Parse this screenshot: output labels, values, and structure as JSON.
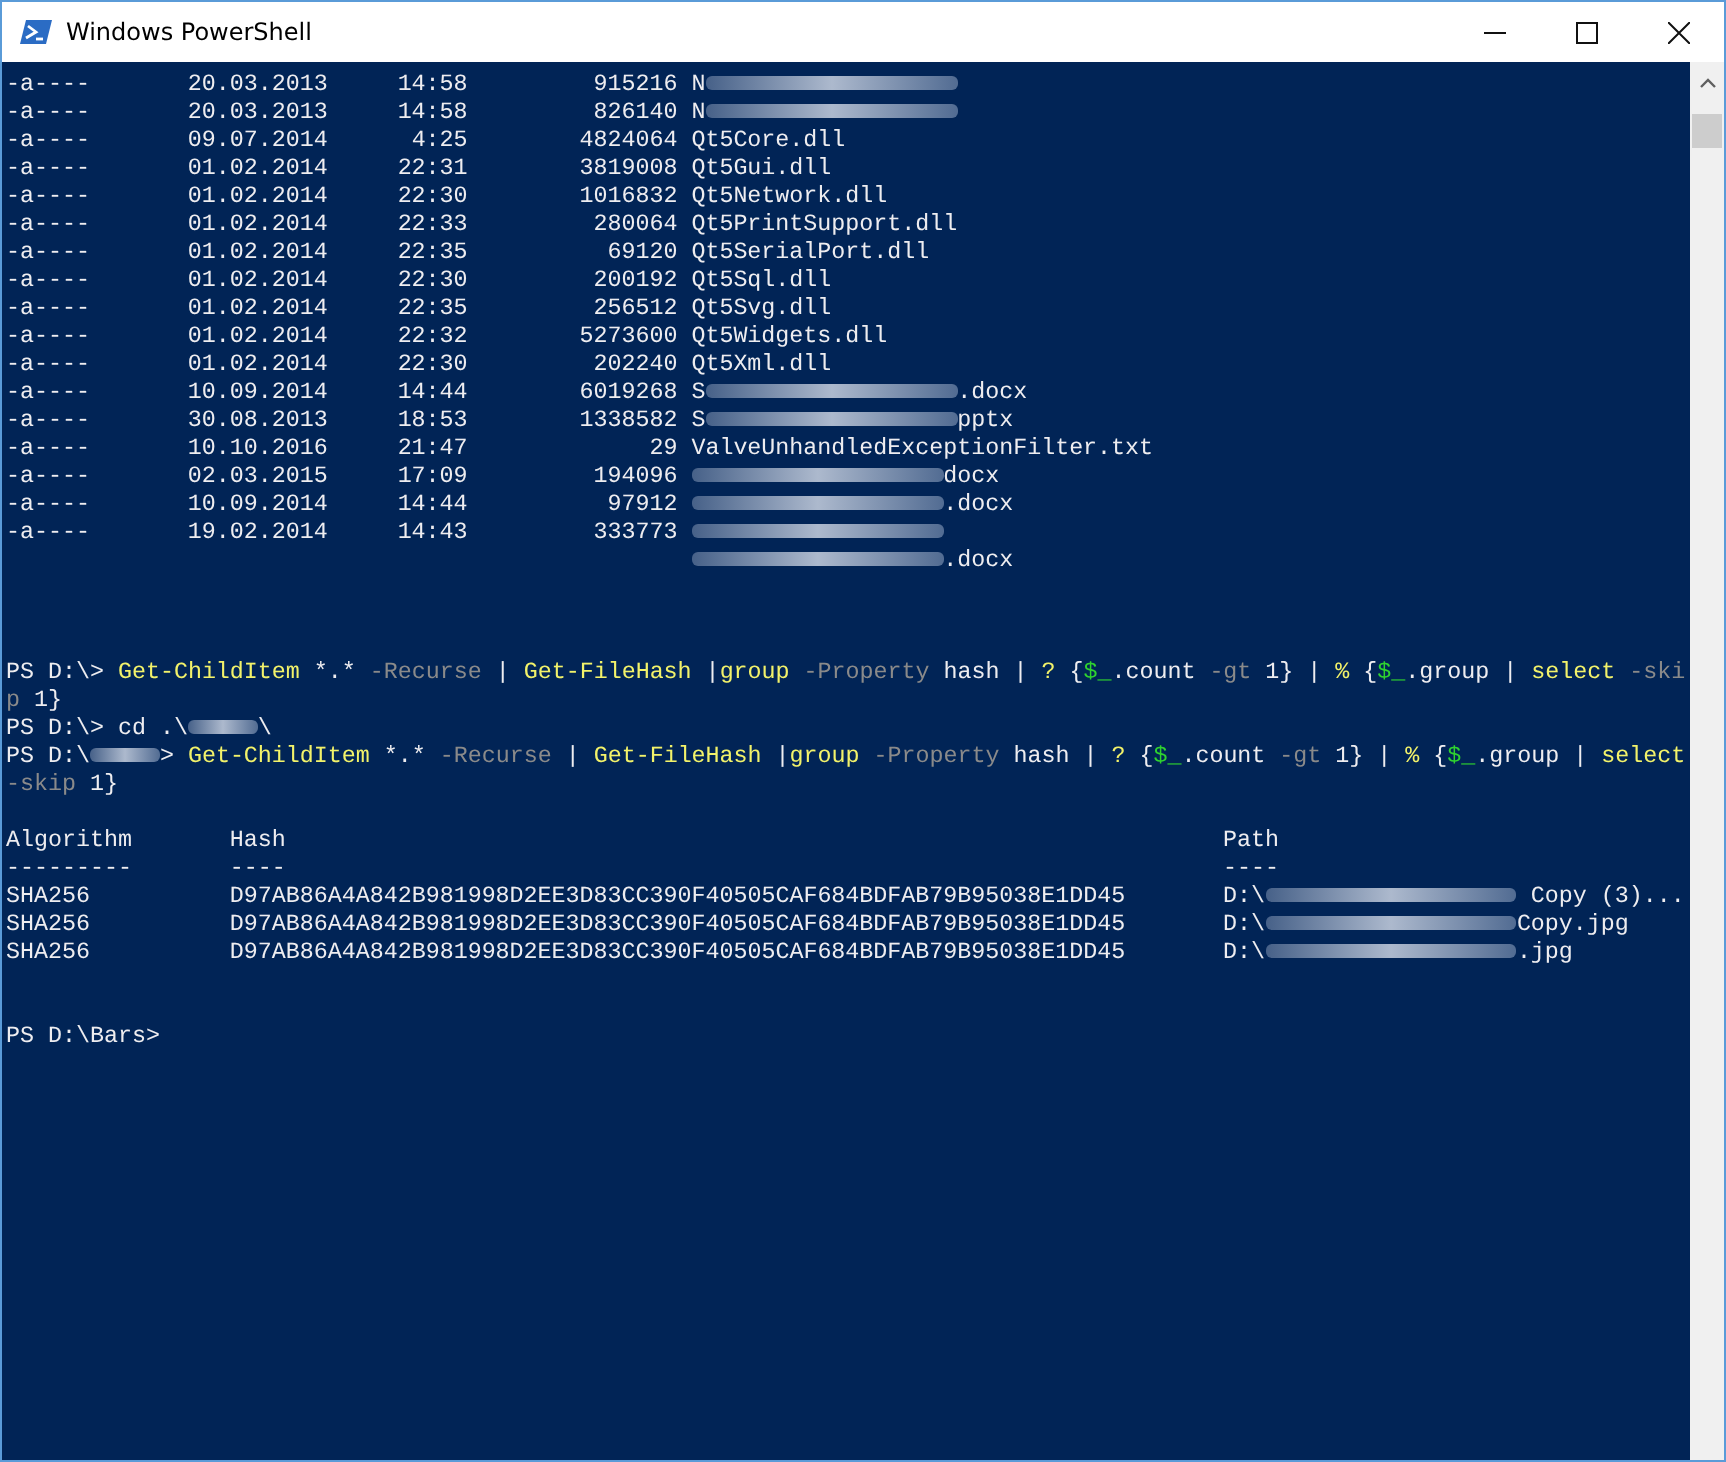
{
  "window": {
    "title": "Windows PowerShell"
  },
  "lines": [
    {
      "kind": "file",
      "mode": "-a----",
      "date": "20.03.2013",
      "time": "14:58",
      "length": "915216",
      "name": [
        {
          "kind": "text",
          "text": "N"
        },
        {
          "kind": "redacted"
        }
      ]
    },
    {
      "kind": "file",
      "mode": "-a----",
      "date": "20.03.2013",
      "time": "14:58",
      "length": "826140",
      "name": [
        {
          "kind": "text",
          "text": "N"
        },
        {
          "kind": "redacted"
        }
      ]
    },
    {
      "kind": "file",
      "mode": "-a----",
      "date": "09.07.2014",
      "time": "4:25",
      "length": "4824064",
      "name": [
        {
          "kind": "text",
          "text": "Qt5Core.dll"
        }
      ]
    },
    {
      "kind": "file",
      "mode": "-a----",
      "date": "01.02.2014",
      "time": "22:31",
      "length": "3819008",
      "name": [
        {
          "kind": "text",
          "text": "Qt5Gui.dll"
        }
      ]
    },
    {
      "kind": "file",
      "mode": "-a----",
      "date": "01.02.2014",
      "time": "22:30",
      "length": "1016832",
      "name": [
        {
          "kind": "text",
          "text": "Qt5Network.dll"
        }
      ]
    },
    {
      "kind": "file",
      "mode": "-a----",
      "date": "01.02.2014",
      "time": "22:33",
      "length": "280064",
      "name": [
        {
          "kind": "text",
          "text": "Qt5PrintSupport.dll"
        }
      ]
    },
    {
      "kind": "file",
      "mode": "-a----",
      "date": "01.02.2014",
      "time": "22:35",
      "length": "69120",
      "name": [
        {
          "kind": "text",
          "text": "Qt5SerialPort.dll"
        }
      ]
    },
    {
      "kind": "file",
      "mode": "-a----",
      "date": "01.02.2014",
      "time": "22:30",
      "length": "200192",
      "name": [
        {
          "kind": "text",
          "text": "Qt5Sql.dll"
        }
      ]
    },
    {
      "kind": "file",
      "mode": "-a----",
      "date": "01.02.2014",
      "time": "22:35",
      "length": "256512",
      "name": [
        {
          "kind": "text",
          "text": "Qt5Svg.dll"
        }
      ]
    },
    {
      "kind": "file",
      "mode": "-a----",
      "date": "01.02.2014",
      "time": "22:32",
      "length": "5273600",
      "name": [
        {
          "kind": "text",
          "text": "Qt5Widgets.dll"
        }
      ]
    },
    {
      "kind": "file",
      "mode": "-a----",
      "date": "01.02.2014",
      "time": "22:30",
      "length": "202240",
      "name": [
        {
          "kind": "text",
          "text": "Qt5Xml.dll"
        }
      ]
    },
    {
      "kind": "file",
      "mode": "-a----",
      "date": "10.09.2014",
      "time": "14:44",
      "length": "6019268",
      "name": [
        {
          "kind": "text",
          "text": "S"
        },
        {
          "kind": "redacted"
        },
        {
          "kind": "text",
          "text": ".docx"
        }
      ]
    },
    {
      "kind": "file",
      "mode": "-a----",
      "date": "30.08.2013",
      "time": "18:53",
      "length": "1338582",
      "name": [
        {
          "kind": "text",
          "text": "S"
        },
        {
          "kind": "redacted"
        },
        {
          "kind": "text",
          "text": "pptx"
        }
      ]
    },
    {
      "kind": "file",
      "mode": "-a----",
      "date": "10.10.2016",
      "time": "21:47",
      "length": "29",
      "name": [
        {
          "kind": "text",
          "text": "ValveUnhandledExceptionFilter.txt"
        }
      ]
    },
    {
      "kind": "file",
      "mode": "-a----",
      "date": "02.03.2015",
      "time": "17:09",
      "length": "194096",
      "name": [
        {
          "kind": "redacted"
        },
        {
          "kind": "text",
          "text": "docx"
        }
      ]
    },
    {
      "kind": "file",
      "mode": "-a----",
      "date": "10.09.2014",
      "time": "14:44",
      "length": "97912",
      "name": [
        {
          "kind": "redacted"
        },
        {
          "kind": "text",
          "text": ".docx"
        }
      ]
    },
    {
      "kind": "file",
      "mode": "-a----",
      "date": "19.02.2014",
      "time": "14:43",
      "length": "333773",
      "name": [
        {
          "kind": "redacted"
        }
      ]
    },
    {
      "kind": "wrap",
      "name": [
        {
          "kind": "redacted"
        },
        {
          "kind": "text",
          "text": ".docx"
        }
      ]
    },
    {
      "kind": "blank"
    },
    {
      "kind": "blank"
    },
    {
      "kind": "blank"
    },
    {
      "kind": "code",
      "segments": [
        {
          "kind": "plain",
          "text": "PS D:\\> "
        },
        {
          "kind": "cmd",
          "text": "Get-ChildItem"
        },
        {
          "kind": "plain",
          "text": " *.* "
        },
        {
          "kind": "param",
          "text": "-Recurse"
        },
        {
          "kind": "plain",
          "text": " | "
        },
        {
          "kind": "cmd",
          "text": "Get-FileHash"
        },
        {
          "kind": "plain",
          "text": " |"
        },
        {
          "kind": "cmd",
          "text": "group"
        },
        {
          "kind": "param",
          "text": " -Property"
        },
        {
          "kind": "plain",
          "text": " hash | "
        },
        {
          "kind": "cmd",
          "text": "?"
        },
        {
          "kind": "plain",
          "text": " {"
        },
        {
          "kind": "var",
          "text": "$_"
        },
        {
          "kind": "plain",
          "text": ".count "
        },
        {
          "kind": "param",
          "text": "-gt"
        },
        {
          "kind": "plain",
          "text": " 1} | "
        },
        {
          "kind": "cmd",
          "text": "%"
        },
        {
          "kind": "plain",
          "text": " {"
        },
        {
          "kind": "var",
          "text": "$_"
        },
        {
          "kind": "plain",
          "text": ".group | "
        },
        {
          "kind": "cmd",
          "text": "select"
        },
        {
          "kind": "param",
          "text": " -ski"
        }
      ]
    },
    {
      "kind": "code",
      "segments": [
        {
          "kind": "param",
          "text": "p"
        },
        {
          "kind": "plain",
          "text": " 1}"
        }
      ]
    },
    {
      "kind": "code",
      "segments": [
        {
          "kind": "plain",
          "text": "PS D:\\> "
        },
        {
          "kind": "plain",
          "text": "cd .\\"
        },
        {
          "kind": "redacted"
        },
        {
          "kind": "plain",
          "text": "\\"
        }
      ]
    },
    {
      "kind": "code",
      "segments": [
        {
          "kind": "plain",
          "text": "PS D:\\"
        },
        {
          "kind": "redacted"
        },
        {
          "kind": "plain",
          "text": "> "
        },
        {
          "kind": "cmd",
          "text": "Get-ChildItem"
        },
        {
          "kind": "plain",
          "text": " *.* "
        },
        {
          "kind": "param",
          "text": "-Recurse"
        },
        {
          "kind": "plain",
          "text": " | "
        },
        {
          "kind": "cmd",
          "text": "Get-FileHash"
        },
        {
          "kind": "plain",
          "text": " |"
        },
        {
          "kind": "cmd",
          "text": "group"
        },
        {
          "kind": "param",
          "text": " -Property"
        },
        {
          "kind": "plain",
          "text": " hash | "
        },
        {
          "kind": "cmd",
          "text": "?"
        },
        {
          "kind": "plain",
          "text": " {"
        },
        {
          "kind": "var",
          "text": "$_"
        },
        {
          "kind": "plain",
          "text": ".count "
        },
        {
          "kind": "param",
          "text": "-gt"
        },
        {
          "kind": "plain",
          "text": " 1} | "
        },
        {
          "kind": "cmd",
          "text": "%"
        },
        {
          "kind": "plain",
          "text": " {"
        },
        {
          "kind": "var",
          "text": "$_"
        },
        {
          "kind": "plain",
          "text": ".group | "
        },
        {
          "kind": "cmd",
          "text": "select"
        }
      ]
    },
    {
      "kind": "code",
      "segments": [
        {
          "kind": "param",
          "text": "-skip"
        },
        {
          "kind": "plain",
          "text": " 1}"
        }
      ]
    },
    {
      "kind": "blank"
    },
    {
      "kind": "table",
      "algorithm": "Algorithm",
      "hash": "Hash",
      "path": [
        {
          "kind": "text",
          "text": "Path"
        }
      ]
    },
    {
      "kind": "table",
      "algorithm": "---------",
      "hash": "----",
      "path": [
        {
          "kind": "text",
          "text": "----"
        }
      ]
    },
    {
      "kind": "table",
      "algorithm": "SHA256",
      "hash": "D97AB86A4A842B981998D2EE3D83CC390F40505CAF684BDFAB79B95038E1DD45",
      "path": [
        {
          "kind": "text",
          "text": "D:\\"
        },
        {
          "kind": "redacted"
        },
        {
          "kind": "text",
          "text": " Copy (3)..."
        }
      ]
    },
    {
      "kind": "table",
      "algorithm": "SHA256",
      "hash": "D97AB86A4A842B981998D2EE3D83CC390F40505CAF684BDFAB79B95038E1DD45",
      "path": [
        {
          "kind": "text",
          "text": "D:\\"
        },
        {
          "kind": "redacted"
        },
        {
          "kind": "text",
          "text": "Copy.jpg"
        }
      ]
    },
    {
      "kind": "table",
      "algorithm": "SHA256",
      "hash": "D97AB86A4A842B981998D2EE3D83CC390F40505CAF684BDFAB79B95038E1DD45",
      "path": [
        {
          "kind": "text",
          "text": "D:\\"
        },
        {
          "kind": "redacted"
        },
        {
          "kind": "text",
          "text": ".jpg"
        }
      ]
    },
    {
      "kind": "blank"
    },
    {
      "kind": "blank"
    },
    {
      "kind": "code",
      "segments": [
        {
          "kind": "plain",
          "text": "PS D:\\Bars>"
        }
      ]
    }
  ]
}
